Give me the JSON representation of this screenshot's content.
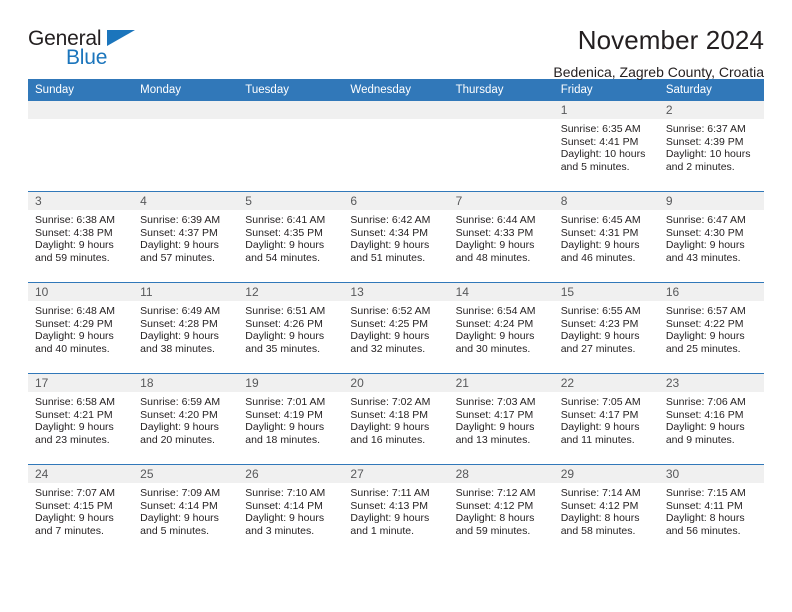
{
  "brand": {
    "name_top": "General",
    "name_bottom": "Blue",
    "accent_color": "#1b75bc"
  },
  "header": {
    "title": "November 2024",
    "subtitle": "Bedenica, Zagreb County, Croatia"
  },
  "theme": {
    "header_blue": "#3178b9",
    "daynum_bg": "#f0f0f0",
    "text": "#231f20"
  },
  "weekday_headers": [
    "Sunday",
    "Monday",
    "Tuesday",
    "Wednesday",
    "Thursday",
    "Friday",
    "Saturday"
  ],
  "labels": {
    "sunrise_prefix": "Sunrise: ",
    "sunset_prefix": "Sunset: ",
    "daylight_prefix": "Daylight: "
  },
  "weeks": [
    [
      {
        "day": "",
        "empty": true
      },
      {
        "day": "",
        "empty": true
      },
      {
        "day": "",
        "empty": true
      },
      {
        "day": "",
        "empty": true
      },
      {
        "day": "",
        "empty": true
      },
      {
        "day": "1",
        "sunrise": "Sunrise: 6:35 AM",
        "sunset": "Sunset: 4:41 PM",
        "daylight_1": "Daylight: 10 hours",
        "daylight_2": "and 5 minutes."
      },
      {
        "day": "2",
        "sunrise": "Sunrise: 6:37 AM",
        "sunset": "Sunset: 4:39 PM",
        "daylight_1": "Daylight: 10 hours",
        "daylight_2": "and 2 minutes."
      }
    ],
    [
      {
        "day": "3",
        "sunrise": "Sunrise: 6:38 AM",
        "sunset": "Sunset: 4:38 PM",
        "daylight_1": "Daylight: 9 hours",
        "daylight_2": "and 59 minutes."
      },
      {
        "day": "4",
        "sunrise": "Sunrise: 6:39 AM",
        "sunset": "Sunset: 4:37 PM",
        "daylight_1": "Daylight: 9 hours",
        "daylight_2": "and 57 minutes."
      },
      {
        "day": "5",
        "sunrise": "Sunrise: 6:41 AM",
        "sunset": "Sunset: 4:35 PM",
        "daylight_1": "Daylight: 9 hours",
        "daylight_2": "and 54 minutes."
      },
      {
        "day": "6",
        "sunrise": "Sunrise: 6:42 AM",
        "sunset": "Sunset: 4:34 PM",
        "daylight_1": "Daylight: 9 hours",
        "daylight_2": "and 51 minutes."
      },
      {
        "day": "7",
        "sunrise": "Sunrise: 6:44 AM",
        "sunset": "Sunset: 4:33 PM",
        "daylight_1": "Daylight: 9 hours",
        "daylight_2": "and 48 minutes."
      },
      {
        "day": "8",
        "sunrise": "Sunrise: 6:45 AM",
        "sunset": "Sunset: 4:31 PM",
        "daylight_1": "Daylight: 9 hours",
        "daylight_2": "and 46 minutes."
      },
      {
        "day": "9",
        "sunrise": "Sunrise: 6:47 AM",
        "sunset": "Sunset: 4:30 PM",
        "daylight_1": "Daylight: 9 hours",
        "daylight_2": "and 43 minutes."
      }
    ],
    [
      {
        "day": "10",
        "sunrise": "Sunrise: 6:48 AM",
        "sunset": "Sunset: 4:29 PM",
        "daylight_1": "Daylight: 9 hours",
        "daylight_2": "and 40 minutes."
      },
      {
        "day": "11",
        "sunrise": "Sunrise: 6:49 AM",
        "sunset": "Sunset: 4:28 PM",
        "daylight_1": "Daylight: 9 hours",
        "daylight_2": "and 38 minutes."
      },
      {
        "day": "12",
        "sunrise": "Sunrise: 6:51 AM",
        "sunset": "Sunset: 4:26 PM",
        "daylight_1": "Daylight: 9 hours",
        "daylight_2": "and 35 minutes."
      },
      {
        "day": "13",
        "sunrise": "Sunrise: 6:52 AM",
        "sunset": "Sunset: 4:25 PM",
        "daylight_1": "Daylight: 9 hours",
        "daylight_2": "and 32 minutes."
      },
      {
        "day": "14",
        "sunrise": "Sunrise: 6:54 AM",
        "sunset": "Sunset: 4:24 PM",
        "daylight_1": "Daylight: 9 hours",
        "daylight_2": "and 30 minutes."
      },
      {
        "day": "15",
        "sunrise": "Sunrise: 6:55 AM",
        "sunset": "Sunset: 4:23 PM",
        "daylight_1": "Daylight: 9 hours",
        "daylight_2": "and 27 minutes."
      },
      {
        "day": "16",
        "sunrise": "Sunrise: 6:57 AM",
        "sunset": "Sunset: 4:22 PM",
        "daylight_1": "Daylight: 9 hours",
        "daylight_2": "and 25 minutes."
      }
    ],
    [
      {
        "day": "17",
        "sunrise": "Sunrise: 6:58 AM",
        "sunset": "Sunset: 4:21 PM",
        "daylight_1": "Daylight: 9 hours",
        "daylight_2": "and 23 minutes."
      },
      {
        "day": "18",
        "sunrise": "Sunrise: 6:59 AM",
        "sunset": "Sunset: 4:20 PM",
        "daylight_1": "Daylight: 9 hours",
        "daylight_2": "and 20 minutes."
      },
      {
        "day": "19",
        "sunrise": "Sunrise: 7:01 AM",
        "sunset": "Sunset: 4:19 PM",
        "daylight_1": "Daylight: 9 hours",
        "daylight_2": "and 18 minutes."
      },
      {
        "day": "20",
        "sunrise": "Sunrise: 7:02 AM",
        "sunset": "Sunset: 4:18 PM",
        "daylight_1": "Daylight: 9 hours",
        "daylight_2": "and 16 minutes."
      },
      {
        "day": "21",
        "sunrise": "Sunrise: 7:03 AM",
        "sunset": "Sunset: 4:17 PM",
        "daylight_1": "Daylight: 9 hours",
        "daylight_2": "and 13 minutes."
      },
      {
        "day": "22",
        "sunrise": "Sunrise: 7:05 AM",
        "sunset": "Sunset: 4:17 PM",
        "daylight_1": "Daylight: 9 hours",
        "daylight_2": "and 11 minutes."
      },
      {
        "day": "23",
        "sunrise": "Sunrise: 7:06 AM",
        "sunset": "Sunset: 4:16 PM",
        "daylight_1": "Daylight: 9 hours",
        "daylight_2": "and 9 minutes."
      }
    ],
    [
      {
        "day": "24",
        "sunrise": "Sunrise: 7:07 AM",
        "sunset": "Sunset: 4:15 PM",
        "daylight_1": "Daylight: 9 hours",
        "daylight_2": "and 7 minutes."
      },
      {
        "day": "25",
        "sunrise": "Sunrise: 7:09 AM",
        "sunset": "Sunset: 4:14 PM",
        "daylight_1": "Daylight: 9 hours",
        "daylight_2": "and 5 minutes."
      },
      {
        "day": "26",
        "sunrise": "Sunrise: 7:10 AM",
        "sunset": "Sunset: 4:14 PM",
        "daylight_1": "Daylight: 9 hours",
        "daylight_2": "and 3 minutes."
      },
      {
        "day": "27",
        "sunrise": "Sunrise: 7:11 AM",
        "sunset": "Sunset: 4:13 PM",
        "daylight_1": "Daylight: 9 hours",
        "daylight_2": "and 1 minute."
      },
      {
        "day": "28",
        "sunrise": "Sunrise: 7:12 AM",
        "sunset": "Sunset: 4:12 PM",
        "daylight_1": "Daylight: 8 hours",
        "daylight_2": "and 59 minutes."
      },
      {
        "day": "29",
        "sunrise": "Sunrise: 7:14 AM",
        "sunset": "Sunset: 4:12 PM",
        "daylight_1": "Daylight: 8 hours",
        "daylight_2": "and 58 minutes."
      },
      {
        "day": "30",
        "sunrise": "Sunrise: 7:15 AM",
        "sunset": "Sunset: 4:11 PM",
        "daylight_1": "Daylight: 8 hours",
        "daylight_2": "and 56 minutes."
      }
    ]
  ]
}
